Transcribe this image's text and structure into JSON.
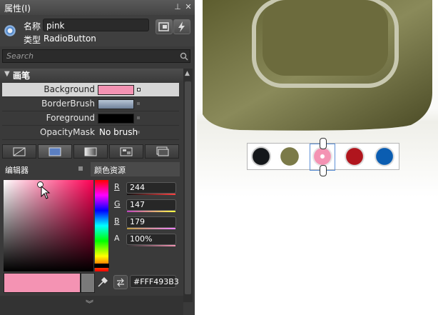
{
  "panel": {
    "title": "属性(I)",
    "name_label": "名称",
    "name_value": "pink",
    "type_label": "类型",
    "type_value": "RadioButton",
    "search_placeholder": "Search"
  },
  "brush": {
    "section_title": "画笔",
    "properties": [
      {
        "label": "Background",
        "swatch": "#f493b3",
        "selected": true
      },
      {
        "label": "BorderBrush",
        "swatch": "#8a9db3",
        "selected": false
      },
      {
        "label": "Foreground",
        "swatch": "#000000",
        "selected": false
      },
      {
        "label": "OpacityMask",
        "text": "No brush",
        "selected": false
      }
    ]
  },
  "brush_tabs": [
    "no-brush",
    "solid-color",
    "gradient",
    "tile",
    "resource"
  ],
  "editor": {
    "tab_editor": "编辑器",
    "tab_resources": "颜色资源",
    "channels": [
      {
        "label": "R",
        "value": "244",
        "bar_color": "#e04040"
      },
      {
        "label": "G",
        "value": "147",
        "bar_color": "#40c040"
      },
      {
        "label": "B",
        "value": "179",
        "bar_color": "#4060e0"
      },
      {
        "label": "A",
        "value": "100%",
        "bar_color": "#f493b3"
      }
    ],
    "hex_value": "#FFF493B3",
    "current_color": "#f493b3"
  },
  "canvas": {
    "radio_buttons": [
      {
        "name": "black",
        "color": "#14171a"
      },
      {
        "name": "olive",
        "color": "#7b7a48"
      },
      {
        "name": "pink",
        "color": "#f493b3",
        "selected": true
      },
      {
        "name": "red",
        "color": "#b0151d"
      },
      {
        "name": "blue",
        "color": "#0b5db1"
      }
    ]
  }
}
